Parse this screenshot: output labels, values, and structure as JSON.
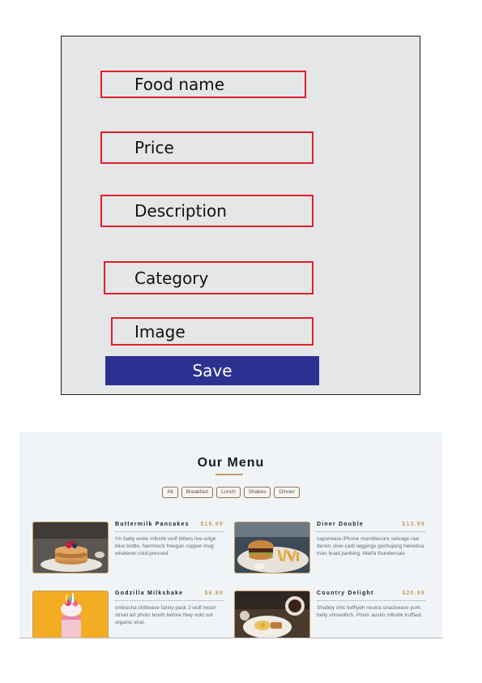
{
  "form": {
    "food_name": "Food name",
    "price": "Price",
    "description": "Description",
    "category": "Category",
    "image": "Image",
    "save_label": "Save"
  },
  "menu": {
    "title": "Our Menu",
    "filters": [
      "All",
      "Breakfast",
      "Lunch",
      "Shakes",
      "Dinner"
    ],
    "items": [
      {
        "name": "Buttermilk Pancakes",
        "price": "$15.99",
        "description": "I'm baby woke mlkshk wolf bitters live-edge blue bottle, hammock freegan copper mug whatever cold-pressed",
        "image": "pancakes-photo"
      },
      {
        "name": "Diner Double",
        "price": "$13.99",
        "description": "vaporware iPhone mumblecore selvage raw denim slow-carb leggings gochujang helvetica man braid jianbing. Marfa thundercats",
        "image": "burger-fries-photo"
      },
      {
        "name": "Godzilla Milkshake",
        "price": "$6.99",
        "description": "ombucha chillwave fanny pack 3 wolf moon street art photo booth before they sold out organic viral.",
        "image": "milkshake-photo"
      },
      {
        "name": "Country Delight",
        "price": "$20.99",
        "description": "Shabby chic keffiyeh neutra snackwave pork belly shoreditch. Prism austin mlkshk truffaut,",
        "image": "breakfast-plate-photo"
      }
    ]
  }
}
